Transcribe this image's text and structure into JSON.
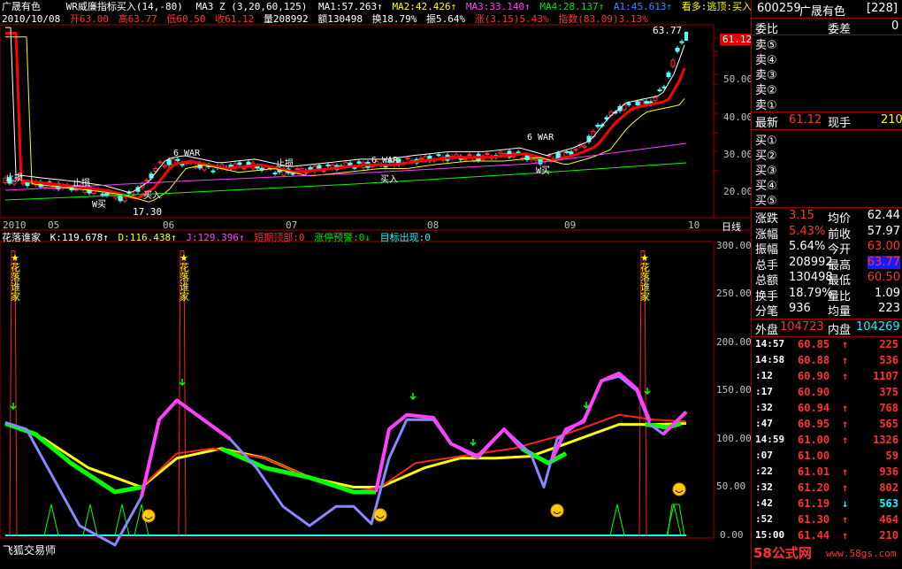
{
  "header": {
    "stock_name": "广晟有色",
    "indicator": "WR威廉指标买入(14,-80)",
    "ma_params": "MA3 Z (3,20,60,125)",
    "ma1": "MA1:57.263↑",
    "ma2": "MA2:42.426↑",
    "ma3": "MA3:33.140↑",
    "ma4": "MA4:28.137↑",
    "a1": "A1:45.613↑",
    "notice": "看多:逃顶:买入持股:卖",
    "date": "2010/10/08",
    "open": "开63.00",
    "high": "高63.77",
    "low": "低60.50",
    "close": "收61.12",
    "volume": "量208992",
    "amount": "额130498",
    "turnover": "换18.79%",
    "amplitude": "振5.64%",
    "change": "涨(3.15)5.43%",
    "index": "指数(83.09)3.13%"
  },
  "price_chart": {
    "y_axis": [
      "60.00",
      "50.00",
      "40.00",
      "30.00",
      "20.00"
    ],
    "months": [
      "2010",
      "05",
      "06",
      "07",
      "08",
      "09",
      "10"
    ],
    "period": "日线",
    "max_label": "63.77",
    "min_label": "17.30",
    "last_price": "61.12",
    "annotations": [
      "止损",
      "止损",
      "止损",
      "买入",
      "买入",
      "6 WAR",
      "6 WAR",
      "6 WAR",
      "W买",
      "W买"
    ]
  },
  "indicator_panel": {
    "name": "花落谁家",
    "k": "K:119.678↑",
    "d": "D:116.438↑",
    "j": "J:129.396↑",
    "top": "短期顶部:0",
    "limit": "涨停预警:0↓",
    "target": "目标出现:0",
    "y_axis": [
      "300.00",
      "250.00",
      "200.00",
      "150.00",
      "100.00",
      "50.00",
      "0.00"
    ],
    "star_labels": [
      "花落谁家",
      "花落谁家",
      "花落谁家"
    ],
    "footer": "飞狐交易师"
  },
  "quote": {
    "code": "600259",
    "name": "广晟有色",
    "num": "[228]",
    "weibi_label": "委比",
    "weicha_label": "委差",
    "weicha_value": "0",
    "sells": [
      "卖⑤",
      "卖④",
      "卖③",
      "卖②",
      "卖①"
    ],
    "latest_label": "最新",
    "latest_value": "61.12",
    "now_label": "现手",
    "now_value": "210",
    "buys": [
      "买①",
      "买②",
      "买③",
      "买④",
      "买⑤"
    ],
    "stats": [
      {
        "l1": "涨跌",
        "v1": "3.15",
        "l2": "均价",
        "v2": "62.44"
      },
      {
        "l1": "涨幅",
        "v1": "5.43%",
        "l2": "前收",
        "v2": "57.97"
      },
      {
        "l1": "振幅",
        "v1": "5.64%",
        "l2": "今开",
        "v2": "63.00"
      },
      {
        "l1": "总手",
        "v1": "208992",
        "l2": "最高",
        "v2": "63.77"
      },
      {
        "l1": "总额",
        "v1": "130498",
        "l2": "最低",
        "v2": "60.50"
      },
      {
        "l1": "换手",
        "v1": "18.79%",
        "l2": "量比",
        "v2": "1.09"
      },
      {
        "l1": "分笔",
        "v1": "936",
        "l2": "均量",
        "v2": "223"
      }
    ],
    "outer_label": "外盘",
    "outer_value": "104723",
    "inner_label": "内盘",
    "inner_value": "104269",
    "ticks": [
      {
        "t": "14:57",
        "p": "60.85",
        "d": "↑",
        "v": "225"
      },
      {
        "t": "14:58",
        "p": "60.88",
        "d": "↑",
        "v": "536"
      },
      {
        "t": ":12",
        "p": "60.90",
        "d": "↑",
        "v": "1107"
      },
      {
        "t": ":17",
        "p": "60.90",
        "d": "",
        "v": "375"
      },
      {
        "t": ":32",
        "p": "60.94",
        "d": "↑",
        "v": "768"
      },
      {
        "t": ":47",
        "p": "60.95",
        "d": "↑",
        "v": "565"
      },
      {
        "t": "14:59",
        "p": "61.00",
        "d": "↑",
        "v": "1326"
      },
      {
        "t": ":07",
        "p": "61.00",
        "d": "",
        "v": "59"
      },
      {
        "t": ":22",
        "p": "61.01",
        "d": "↑",
        "v": "936"
      },
      {
        "t": ":32",
        "p": "61.20",
        "d": "↑",
        "v": "802"
      },
      {
        "t": ":42",
        "p": "61.19",
        "d": "↓",
        "v": "563"
      },
      {
        "t": ":52",
        "p": "61.30",
        "d": "↑",
        "v": "464"
      },
      {
        "t": "15:00",
        "p": "61.44",
        "d": "↑",
        "v": "210"
      }
    ],
    "watermark": "58公式网",
    "watermark_url": "www.58gs.com"
  }
}
